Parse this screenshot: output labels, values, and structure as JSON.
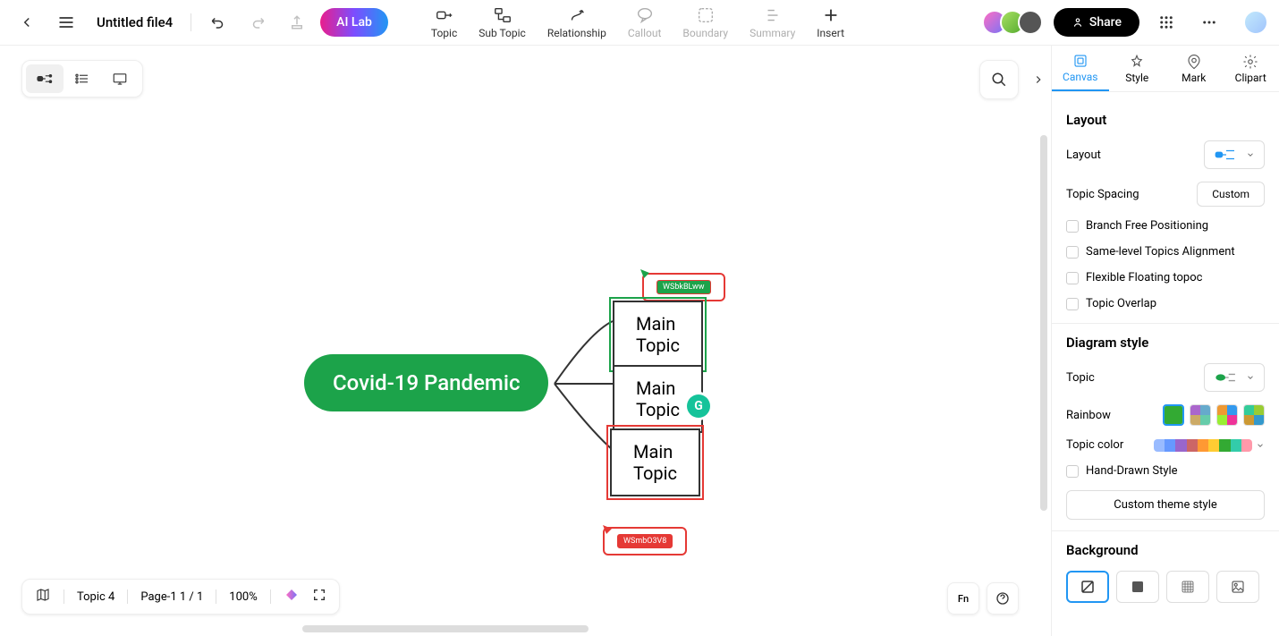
{
  "header": {
    "file_name": "Untitled file4",
    "ai_lab": "AI Lab",
    "share": "Share"
  },
  "tools": {
    "topic": "Topic",
    "sub_topic": "Sub Topic",
    "relationship": "Relationship",
    "callout": "Callout",
    "boundary": "Boundary",
    "summary": "Summary",
    "insert": "Insert"
  },
  "mindmap": {
    "central": "Covid-19 Pandemic",
    "topic1": "Main Topic",
    "topic2": "Main Topic",
    "topic3": "Main Topic",
    "cursor1": "WSbkBLww",
    "cursor2": "WSmbO3V8"
  },
  "bottom": {
    "topic_count": "Topic 4",
    "page": "Page-1  1 / 1",
    "zoom": "100%"
  },
  "panel": {
    "tabs": {
      "canvas": "Canvas",
      "style": "Style",
      "mark": "Mark",
      "clipart": "Clipart"
    },
    "layout_section": "Layout",
    "layout_label": "Layout",
    "topic_spacing": "Topic Spacing",
    "custom": "Custom",
    "branch_free": "Branch Free Positioning",
    "same_level": "Same-level Topics Alignment",
    "flexible": "Flexible Floating topoc",
    "overlap": "Topic Overlap",
    "diagram_section": "Diagram style",
    "topic_label": "Topic",
    "rainbow": "Rainbow",
    "topic_color": "Topic color",
    "hand_drawn": "Hand-Drawn Style",
    "custom_theme": "Custom theme style",
    "background_section": "Background"
  },
  "colors": {
    "primary_green": "#1ca34a",
    "accent_blue": "#2196f3",
    "red": "#e53935",
    "palette": [
      "#99bbff",
      "#6699ff",
      "#9966cc",
      "#cc6666",
      "#ff9933",
      "#ffcc33",
      "#33aa33",
      "#33ccaa",
      "#ff99aa"
    ]
  }
}
